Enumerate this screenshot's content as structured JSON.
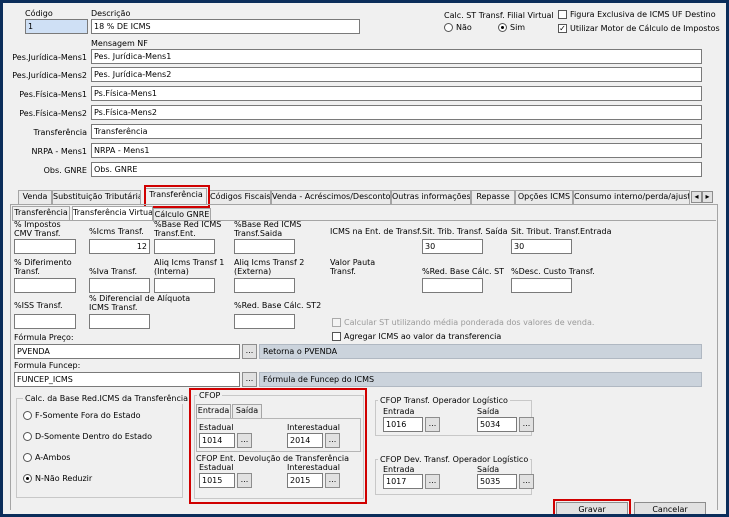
{
  "header": {
    "codigo_label": "Código",
    "codigo_value": "1",
    "descricao_label": "Descrição",
    "descricao_value": "18 % DE ICMS",
    "calc_st_label": "Calc. ST Transf. Filial Virtual",
    "radio_nao": "Não",
    "radio_sim": "Sim",
    "radio_selected": "Sim",
    "fig_excl_label": "Figura Exclusiva de ICMS UF Destino",
    "fig_excl_checked": false,
    "motor_label": "Utilizar Motor de Cálculo de Impostos",
    "motor_checked": true
  },
  "mensagem": {
    "title": "Mensagem NF",
    "rows": [
      {
        "label": "Pes.Jurídica-Mens1",
        "value": "Pes. Jurídica-Mens1"
      },
      {
        "label": "Pes.Jurídica-Mens2",
        "value": "Pes. Jurídica-Mens2"
      },
      {
        "label": "Pes.Física-Mens1",
        "value": "Ps.Física-Mens1"
      },
      {
        "label": "Pes.Física-Mens2",
        "value": "Ps.Física-Mens2"
      },
      {
        "label": "Transferência",
        "value": "Transferência"
      },
      {
        "label": "NRPA - Mens1",
        "value": "NRPA - Mens1"
      },
      {
        "label": "Obs. GNRE",
        "value": "Obs. GNRE"
      }
    ]
  },
  "main_tabs": [
    "Venda",
    "Substituição Tributária",
    "Transferência",
    "Códigos Fiscais",
    "Venda - Acréscimos/Descontos",
    "Outras informações",
    "Repasse",
    "Opções ICMS",
    "Consumo interno/perda/ajuste"
  ],
  "main_tab_selected": "Transferência",
  "sub_tabs": [
    "Transferência",
    "Transferência Virtual",
    "Cálculo GNRE"
  ],
  "sub_tab_selected": "Transferência Virtual",
  "fields": {
    "imp_cmv_l1": "% Impostos",
    "imp_cmv_l2": "CMV Transf.",
    "imp_cmv": "",
    "icms_transf_l": "%Icms Transf.",
    "icms_transf": "12",
    "base_red_ent_l1": "%Base Red ICMS",
    "base_red_ent_l2": "Transf.Ent.",
    "base_red_ent": "",
    "base_red_sai_l1": "%Base Red ICMS",
    "base_red_sai_l2": "Transf.Saida",
    "base_red_sai": "",
    "icms_ent_transf_l": "ICMS na Ent. de Transf.",
    "sit_trib_sai_l": "Sit. Trib. Transf. Saída",
    "sit_trib_sai": "30",
    "sit_trib_ent_l": "Sit. Tribut. Transf.Entrada",
    "sit_trib_ent": "30",
    "diferimento_l1": "% Diferimento",
    "diferimento_l2": "Transf.",
    "diferimento": "",
    "iva_l": "%Iva Transf.",
    "iva": "",
    "aliq1_l1": "Aliq Icms Transf 1",
    "aliq1_l2": "(Interna)",
    "aliq1": "",
    "aliq2_l1": "Aliq Icms Transf 2",
    "aliq2_l2": "(Externa)",
    "aliq2": "",
    "valor_pauta_l1": "Valor Pauta",
    "valor_pauta_l2": "Transf.",
    "red_base_st_l": "%Red. Base Cálc. ST",
    "red_base_st": "",
    "desc_custo_l": "%Desc. Custo Transf.",
    "desc_custo": "",
    "iss_l": "%ISS  Transf.",
    "iss": "",
    "dif_aliq_l1": "% Diferencial de Alíquota",
    "dif_aliq_l2": "ICMS Transf.",
    "dif_aliq": "",
    "red_base_st2_l": "%Red. Base Cálc. ST2",
    "red_base_st2": "",
    "calc_st_media": "Calcular ST utilizando média ponderada dos valores de venda.",
    "agregar_icms": "Agregar ICMS ao valor da transferencia",
    "formula_preco_l": "Fórmula Preço:",
    "formula_preco": "PVENDA",
    "formula_preco_info": "Retorna o PVENDA",
    "formula_funcep_l": "Formula Funcep:",
    "formula_funcep": "FUNCEP_ICMS",
    "formula_funcep_info": "Fórmula de Funcep do ICMS",
    "ellipsis": "..."
  },
  "calc_base": {
    "title": "Calc. da Base Red.ICMS da Transferência",
    "options": [
      "F-Somente Fora do Estado",
      "D-Somente Dentro do Estado",
      "A-Ambos",
      "N-Não Reduzir"
    ],
    "selected": "N-Não Reduzir"
  },
  "cfop": {
    "title": "CFOP",
    "tabs": [
      "Entrada",
      "Saída"
    ],
    "estadual_l": "Estadual",
    "estadual": "1014",
    "interestadual_l": "Interestadual",
    "interestadual": "2014",
    "dev_title": "CFOP Ent. Devolução de Transferência",
    "dev_estadual": "1015",
    "dev_interestadual": "2015"
  },
  "cfop_op": {
    "title": "CFOP Transf. Operador Logístico",
    "entrada_l": "Entrada",
    "entrada": "1016",
    "saida_l": "Saída",
    "saida": "5034",
    "dev_title": "CFOP Dev. Transf. Operador Logístico",
    "dev_entrada": "1017",
    "dev_saida": "5035"
  },
  "buttons": {
    "gravar": "Gravar",
    "cancelar": "Cancelar"
  },
  "colors": {
    "highlight": "#d00000",
    "window_frame": "#0b2d5a",
    "info_box": "#cbd3dc"
  }
}
